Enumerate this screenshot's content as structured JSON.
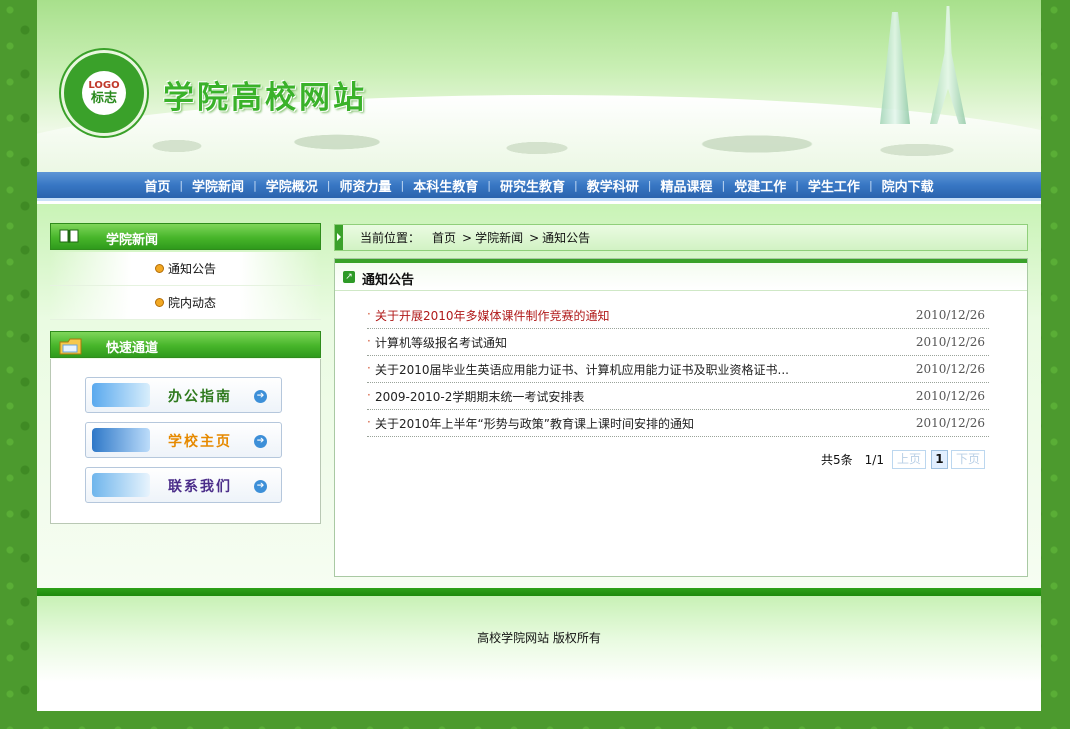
{
  "header": {
    "logo_text_1": "LOGO",
    "logo_text_2": "标志",
    "site_title": "学院高校网站"
  },
  "nav": {
    "items": [
      "首页",
      "学院新闻",
      "学院概况",
      "师资力量",
      "本科生教育",
      "研究生教育",
      "教学科研",
      "精品课程",
      "党建工作",
      "学生工作",
      "院内下载"
    ],
    "separator": "|"
  },
  "sidebar": {
    "news_title": "学院新闻",
    "news_items": [
      "通知公告",
      "院内动态"
    ],
    "quick_title": "快速通道",
    "quick_links": [
      "办公指南",
      "学校主页",
      "联系我们"
    ]
  },
  "breadcrumb": {
    "label": "当前位置：",
    "items": [
      "首页",
      "学院新闻",
      "通知公告"
    ],
    "gt": ">"
  },
  "panel": {
    "title": "通知公告",
    "articles": [
      {
        "title": "关于开展2010年多媒体课件制作竞赛的通知",
        "date": "2010/12/26"
      },
      {
        "title": "计算机等级报名考试通知",
        "date": "2010/12/26"
      },
      {
        "title": "关于2010届毕业生英语应用能力证书、计算机应用能力证书及职业资格证书...",
        "date": "2010/12/26"
      },
      {
        "title": "2009-2010-2学期期末统一考试安排表",
        "date": "2010/12/26"
      },
      {
        "title": "关于2010年上半年“形势与政策”教育课上课时间安排的通知",
        "date": "2010/12/26"
      }
    ],
    "pager": {
      "total": "共5条",
      "page": "1/1",
      "prev": "上页",
      "current": "1",
      "next": "下页"
    }
  },
  "footer": {
    "copyright": "高校学院网站  版权所有"
  },
  "colors": {
    "brand_green": "#3aa12a",
    "nav_blue": "#3877c4",
    "hot_link": "#b01a1a"
  },
  "icons": {
    "news_head": "book-icon",
    "quick_head": "folder-icon",
    "panel_head": "arrow-square-icon",
    "list_bullet": "orange-dot-icon"
  }
}
